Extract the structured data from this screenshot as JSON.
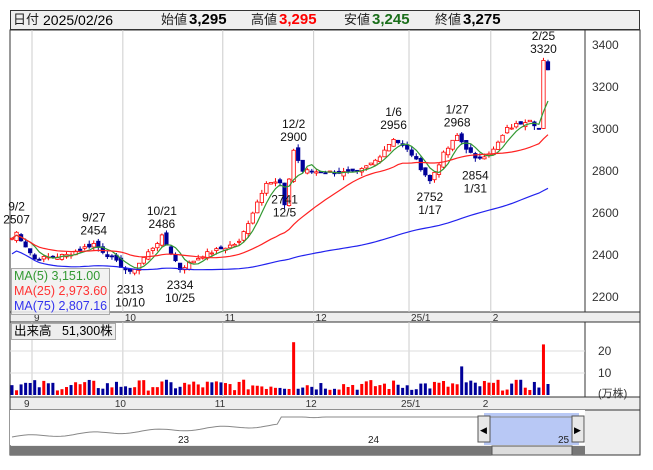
{
  "header": {
    "date_label": "日付",
    "date": "2025/02/26",
    "open_label": "始値",
    "open": "3,295",
    "high_label": "高値",
    "high": "3,295",
    "low_label": "安値",
    "low": "3,245",
    "close_label": "終値",
    "close": "3,275"
  },
  "legend": {
    "ma5": "MA(5)",
    "ma5_val": "3,151.00",
    "ma25": "MA(25)",
    "ma25_val": "2,973.60",
    "ma75": "MA(75)",
    "ma75_val": "2,807.16"
  },
  "volume": {
    "label": "出来高",
    "value": "51,300株",
    "unit": "(万株)"
  },
  "navigator": {
    "years": [
      "23",
      "24",
      "25"
    ]
  },
  "colors": {
    "up": "#ff0000",
    "down": "#000099",
    "ma5": "#339933",
    "ma25": "#ff2222",
    "ma75": "#2222ee"
  },
  "chart_data": {
    "type": "candlestick",
    "ylim": [
      2100,
      3450
    ],
    "yticks": [
      2200,
      2400,
      2600,
      2800,
      3000,
      3200,
      3400
    ],
    "xticks": [
      {
        "label": "9",
        "day": 0
      },
      {
        "label": "10",
        "day": 20
      },
      {
        "label": "11",
        "day": 42
      },
      {
        "label": "12",
        "day": 62
      },
      {
        "label": "25/1",
        "day": 83
      },
      {
        "label": "2",
        "day": 101
      }
    ],
    "keypoints": [
      [
        0,
        2480
      ],
      [
        1,
        2507
      ],
      [
        5,
        2380
      ],
      [
        12,
        2400
      ],
      [
        18,
        2454
      ],
      [
        26,
        2313
      ],
      [
        33,
        2486
      ],
      [
        37,
        2334
      ],
      [
        42,
        2400
      ],
      [
        50,
        2460
      ],
      [
        56,
        2750
      ],
      [
        59,
        2741
      ],
      [
        60,
        2630
      ],
      [
        62,
        2900
      ],
      [
        64,
        2800
      ],
      [
        76,
        2790
      ],
      [
        80,
        2850
      ],
      [
        84,
        2956
      ],
      [
        88,
        2880
      ],
      [
        92,
        2752
      ],
      [
        95,
        2880
      ],
      [
        98,
        2968
      ],
      [
        102,
        2854
      ],
      [
        106,
        2900
      ],
      [
        109,
        3000
      ],
      [
        114,
        3050
      ],
      [
        116,
        3000
      ],
      [
        117,
        3320
      ],
      [
        118,
        3275
      ]
    ],
    "annotations": [
      {
        "day": 1,
        "price": 2507,
        "date": "9/2",
        "pos": "above"
      },
      {
        "day": 18,
        "price": 2454,
        "date": "9/27",
        "pos": "above"
      },
      {
        "day": 26,
        "price": 2313,
        "date": "10/10",
        "pos": "below"
      },
      {
        "day": 33,
        "price": 2486,
        "date": "10/21",
        "pos": "above"
      },
      {
        "day": 37,
        "price": 2334,
        "date": "10/25",
        "pos": "below"
      },
      {
        "day": 62,
        "price": 2900,
        "date": "12/2",
        "pos": "above"
      },
      {
        "day": 60,
        "price": 2741,
        "date": "12/5",
        "pos": "below"
      },
      {
        "day": 84,
        "price": 2956,
        "date": "1/6",
        "pos": "above"
      },
      {
        "day": 92,
        "price": 2752,
        "date": "1/17",
        "pos": "below"
      },
      {
        "day": 98,
        "price": 2968,
        "date": "1/27",
        "pos": "above"
      },
      {
        "day": 102,
        "price": 2854,
        "date": "1/31",
        "pos": "below"
      },
      {
        "day": 117,
        "price": 3320,
        "date": "2/25",
        "pos": "above"
      }
    ],
    "volume_ylim": [
      0,
      30
    ],
    "volume_yticks": [
      10,
      20
    ],
    "volume_spikes": [
      [
        62,
        24
      ],
      [
        99,
        13
      ],
      [
        117,
        23
      ],
      [
        118,
        5
      ]
    ]
  }
}
